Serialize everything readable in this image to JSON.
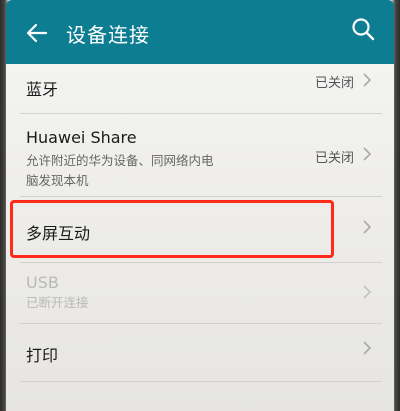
{
  "appbar": {
    "title": "设备连接",
    "back_icon": "back-arrow-icon",
    "search_icon": "search-icon",
    "color": "#0d7d92"
  },
  "settings": [
    {
      "title": "蓝牙",
      "status": "已关闭"
    },
    {
      "title": "Huawei Share",
      "subtitle_line1": "允许附近的华为设备、同网络内电",
      "subtitle_line2": "脑发现本机",
      "status": "已关闭"
    },
    {
      "title": "多屏互动"
    },
    {
      "title": "USB",
      "subtitle": "已断开连接",
      "disabled": true
    },
    {
      "title": "打印"
    }
  ],
  "highlight_color": "#ff2a1a"
}
